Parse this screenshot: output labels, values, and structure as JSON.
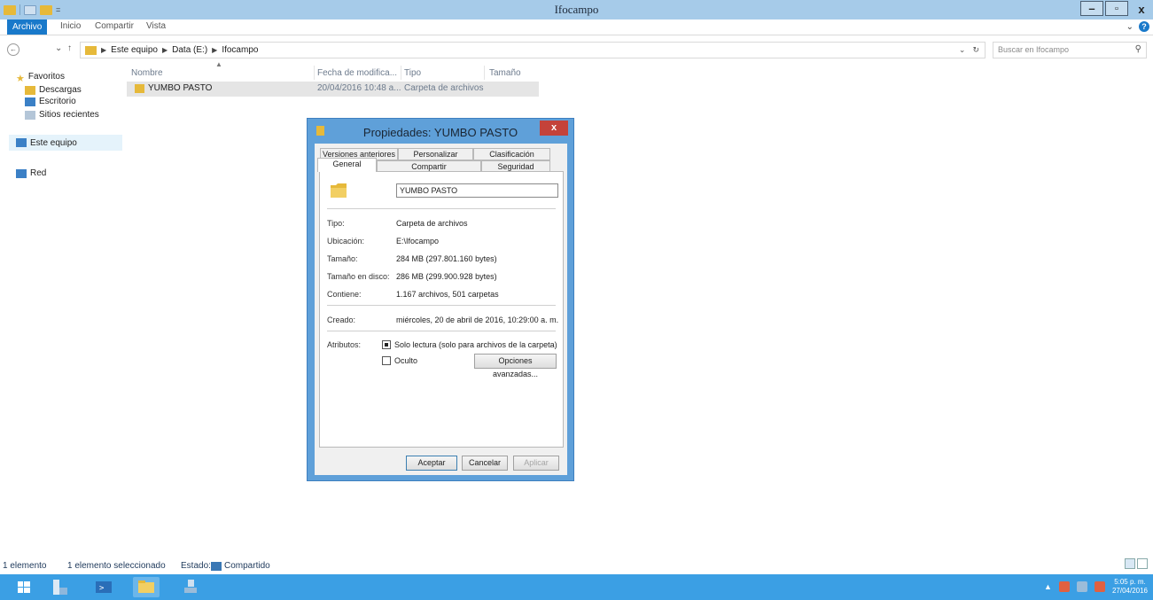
{
  "window": {
    "title": "Ifocampo"
  },
  "ribbon": {
    "tabs": [
      "Archivo",
      "Inicio",
      "Compartir",
      "Vista"
    ]
  },
  "address": {
    "path": [
      "Este equipo",
      "Data (E:)",
      "Ifocampo"
    ],
    "search_placeholder": "Buscar en Ifocampo"
  },
  "nav": {
    "favorites": "Favoritos",
    "items": [
      "Descargas",
      "Escritorio",
      "Sitios recientes"
    ],
    "this_pc": "Este equipo",
    "network": "Red"
  },
  "filelist": {
    "columns": [
      "Nombre",
      "Fecha de modifica...",
      "Tipo",
      "Tamaño"
    ],
    "rows": [
      {
        "name": "YUMBO PASTO",
        "date": "20/04/2016 10:48 a...",
        "type": "Carpeta de archivos"
      }
    ]
  },
  "dialog": {
    "title": "Propiedades: YUMBO PASTO",
    "close_label": "x",
    "tabs_top": [
      "Versiones anteriores",
      "Personalizar",
      "Clasificación"
    ],
    "tabs_bottom": [
      "General",
      "Compartir",
      "Seguridad"
    ],
    "name_value": "YUMBO PASTO",
    "fields": [
      {
        "label": "Tipo:",
        "value": "Carpeta de archivos"
      },
      {
        "label": "Ubicación:",
        "value": "E:\\Ifocampo"
      },
      {
        "label": "Tamaño:",
        "value": "284 MB (297.801.160 bytes)"
      },
      {
        "label": "Tamaño en disco:",
        "value": "286 MB (299.900.928 bytes)"
      },
      {
        "label": "Contiene:",
        "value": "1.167 archivos, 501 carpetas"
      }
    ],
    "created_label": "Creado:",
    "created_value": "miércoles, 20 de abril de 2016, 10:29:00 a. m.",
    "attributes_label": "Atributos:",
    "readonly_label": "Solo lectura (solo para archivos de la carpeta)",
    "hidden_label": "Oculto",
    "advanced_button": "Opciones avanzadas...",
    "buttons": {
      "ok": "Aceptar",
      "cancel": "Cancelar",
      "apply": "Aplicar"
    }
  },
  "status": {
    "count": "1 elemento",
    "selected": "1 elemento seleccionado",
    "state_label": "Estado:",
    "state_value": "Compartido"
  },
  "taskbar": {
    "time": "5:05 p. m.",
    "date": "27/04/2016"
  },
  "colors": {
    "accent": "#1979ca",
    "taskbar": "#3b9fe4",
    "dialog_frame": "#5fa0d9",
    "close": "#c4423a"
  }
}
